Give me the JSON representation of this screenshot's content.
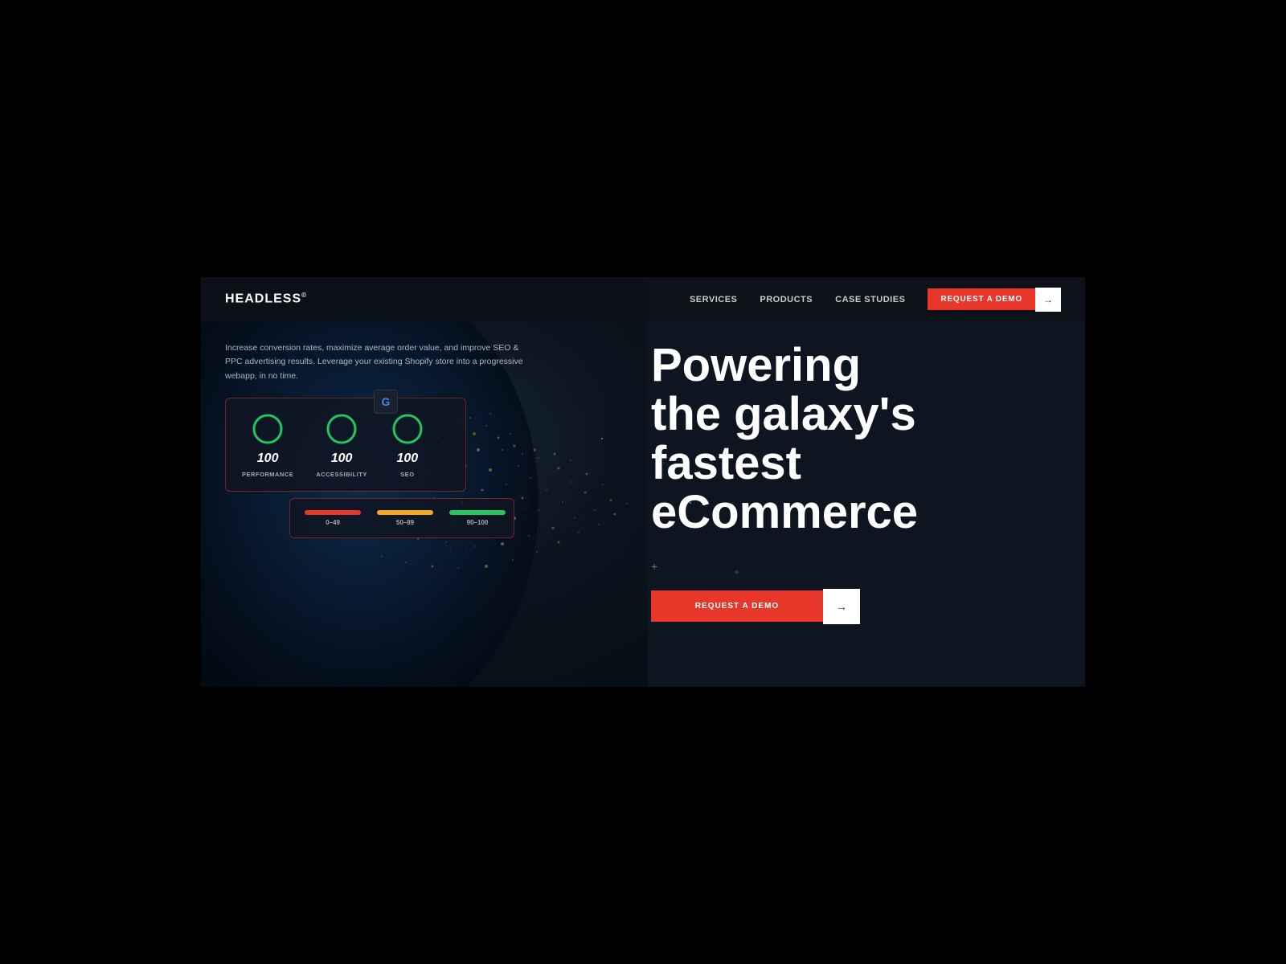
{
  "brand": {
    "logo": "HEADLESS",
    "logo_sup": "©"
  },
  "nav": {
    "links": [
      {
        "id": "services",
        "label": "SERVICES"
      },
      {
        "id": "products",
        "label": "PRODUCTS"
      },
      {
        "id": "case-studies",
        "label": "CASE STUDIES"
      }
    ],
    "cta_label": "REQUEST A DEMO",
    "cta_arrow": "→"
  },
  "hero": {
    "tagline": "Increase conversion rates, maximize average order value, and improve SEO & PPC advertising results. Leverage your existing Shopify store into a progressive webapp, in no time.",
    "title_line1": "Powering",
    "title_line2": "the galaxy's",
    "title_line3": "fastest",
    "title_line4": "eCommerce",
    "cta_label": "REQUEST A DEMO",
    "cta_arrow": "→"
  },
  "scores": [
    {
      "id": "performance",
      "value": "100",
      "label": "PERFORMANCE",
      "color": "#22c55e",
      "percent": 100
    },
    {
      "id": "accessibility",
      "value": "100",
      "label": "ACCESSIBILITY",
      "color": "#22c55e",
      "percent": 100
    },
    {
      "id": "seo",
      "value": "100",
      "label": "SEO",
      "color": "#22c55e",
      "percent": 100
    }
  ],
  "legend": [
    {
      "id": "low",
      "label": "0–49",
      "color": "#e8372a"
    },
    {
      "id": "mid",
      "label": "50–89",
      "color": "#f5a623"
    },
    {
      "id": "high",
      "label": "90–100",
      "color": "#22c55e"
    }
  ],
  "colors": {
    "brand_red": "#e8372a",
    "bg_dark": "#0d1117",
    "bg_right": "#0e1420",
    "green": "#22c55e",
    "orange": "#f5a623"
  },
  "deco": {
    "plus1": "+",
    "plus2": "+",
    "plus3": "+",
    "google_letter": "G"
  }
}
